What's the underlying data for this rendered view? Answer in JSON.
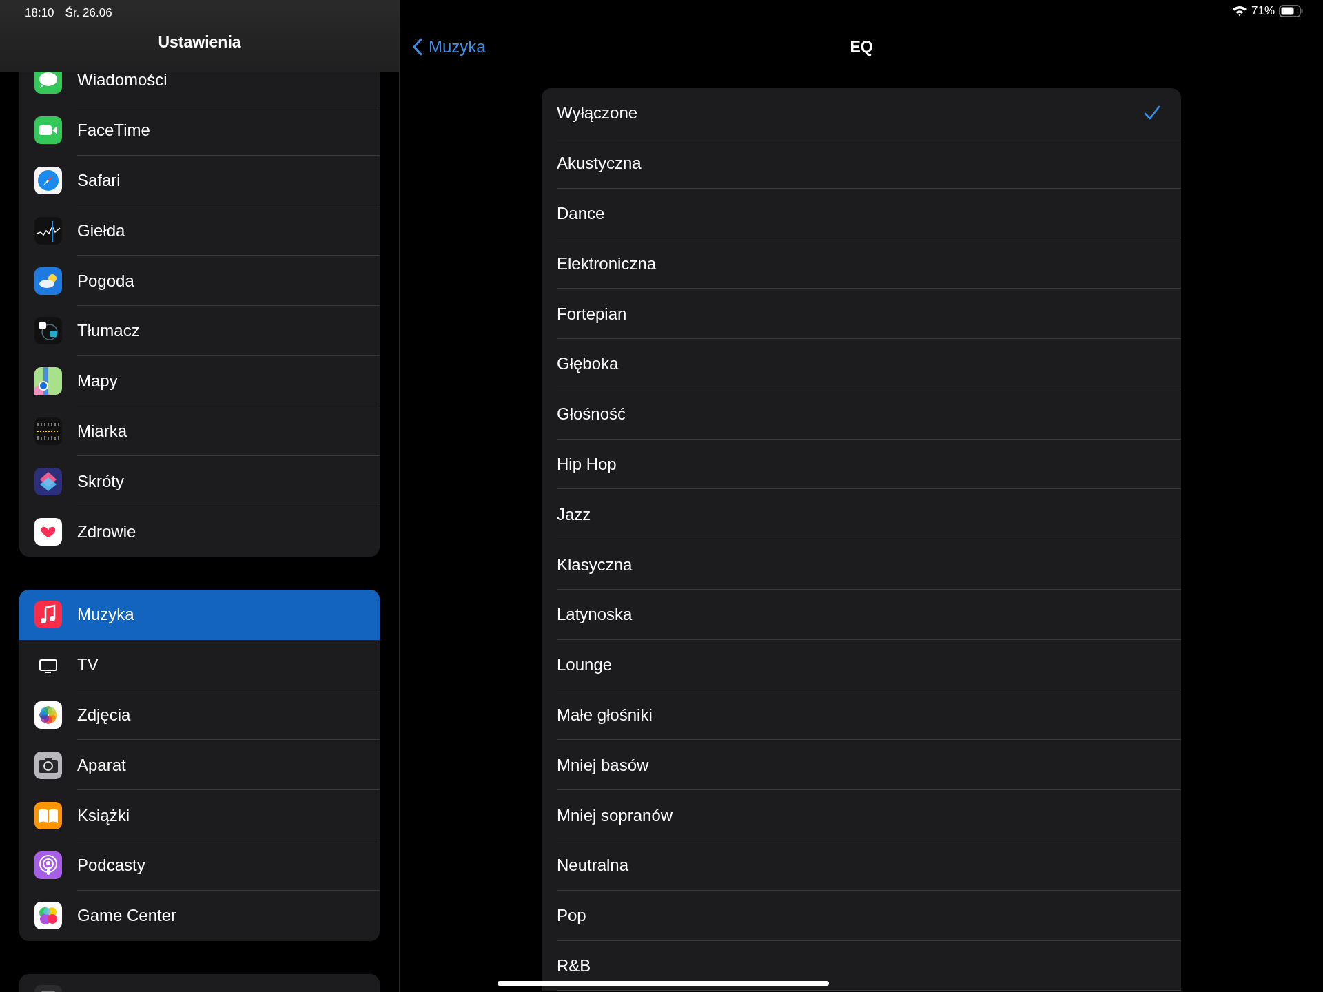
{
  "status_bar": {
    "time": "18:10",
    "date": "Śr. 26.06",
    "battery": "71%"
  },
  "sidebar": {
    "title": "Ustawienia",
    "groups": [
      {
        "items": [
          {
            "label": "Wiadomości",
            "selected": false
          },
          {
            "label": "FaceTime",
            "selected": false
          },
          {
            "label": "Safari",
            "selected": false
          },
          {
            "label": "Giełda",
            "selected": false
          },
          {
            "label": "Pogoda",
            "selected": false
          },
          {
            "label": "Tłumacz",
            "selected": false
          },
          {
            "label": "Mapy",
            "selected": false
          },
          {
            "label": "Miarka",
            "selected": false
          },
          {
            "label": "Skróty",
            "selected": false
          },
          {
            "label": "Zdrowie",
            "selected": false
          }
        ]
      },
      {
        "items": [
          {
            "label": "Muzyka",
            "selected": true
          },
          {
            "label": "TV",
            "selected": false
          },
          {
            "label": "Zdjęcia",
            "selected": false
          },
          {
            "label": "Aparat",
            "selected": false
          },
          {
            "label": "Książki",
            "selected": false
          },
          {
            "label": "Podcasty",
            "selected": false
          },
          {
            "label": "Game Center",
            "selected": false
          }
        ]
      }
    ]
  },
  "detail": {
    "back": "Muzyka",
    "title": "EQ",
    "options": [
      {
        "label": "Wyłączone",
        "selected": true
      },
      {
        "label": "Akustyczna",
        "selected": false
      },
      {
        "label": "Dance",
        "selected": false
      },
      {
        "label": "Elektroniczna",
        "selected": false
      },
      {
        "label": "Fortepian",
        "selected": false
      },
      {
        "label": "Głęboka",
        "selected": false
      },
      {
        "label": "Głośność",
        "selected": false
      },
      {
        "label": "Hip Hop",
        "selected": false
      },
      {
        "label": "Jazz",
        "selected": false
      },
      {
        "label": "Klasyczna",
        "selected": false
      },
      {
        "label": "Latynoska",
        "selected": false
      },
      {
        "label": "Lounge",
        "selected": false
      },
      {
        "label": "Małe głośniki",
        "selected": false
      },
      {
        "label": "Mniej basów",
        "selected": false
      },
      {
        "label": "Mniej sopranów",
        "selected": false
      },
      {
        "label": "Neutralna",
        "selected": false
      },
      {
        "label": "Pop",
        "selected": false
      },
      {
        "label": "R&B",
        "selected": false
      }
    ]
  }
}
